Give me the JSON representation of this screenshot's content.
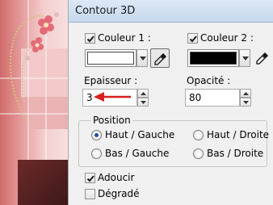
{
  "title": "Contour 3D",
  "colors": {
    "color1": "#ffffff",
    "color2": "#000000",
    "annotation_arrow": "#d81e1e"
  },
  "couleur1": {
    "label": "Couleur 1 :",
    "checked": true
  },
  "couleur2": {
    "label": "Couleur 2 :",
    "checked": true
  },
  "epaisseur": {
    "label": "Epaisseur :",
    "value": "3"
  },
  "opacite": {
    "label": "Opacité :",
    "value": "80"
  },
  "position": {
    "label": "Position",
    "options": [
      "Haut / Gauche",
      "Haut / Droite",
      "Bas / Gauche",
      "Bas / Droite"
    ],
    "selected": "Haut / Gauche"
  },
  "adoucir": {
    "label": "Adoucir",
    "checked": true
  },
  "degrade": {
    "label": "Dégradé",
    "checked": false
  },
  "icons": {
    "picker": "eyedropper-icon",
    "dropdown": "chevron-down-icon",
    "spin_up": "spin-up-icon",
    "spin_down": "spin-down-icon"
  }
}
